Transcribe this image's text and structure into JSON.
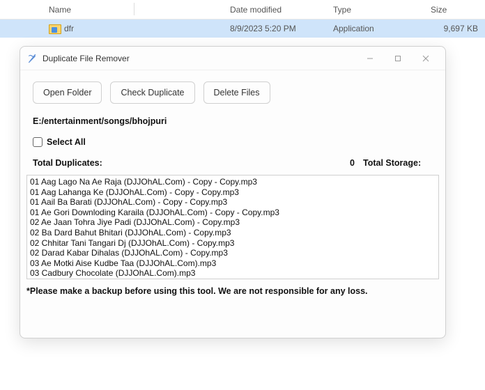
{
  "explorer": {
    "columns": {
      "name": "Name",
      "date": "Date modified",
      "type": "Type",
      "size": "Size"
    },
    "row": {
      "name": "dfr",
      "date": "8/9/2023 5:20 PM",
      "type": "Application",
      "size": "9,697 KB"
    }
  },
  "app": {
    "title": "Duplicate File Remover",
    "buttons": {
      "open": "Open Folder",
      "check": "Check Duplicate",
      "delete": "Delete Files"
    },
    "path": "E:/entertainment/songs/bhojpuri",
    "select_all": "Select All",
    "total_duplicates_label": "Total Duplicates:",
    "total_duplicates_count": "0",
    "total_storage_label": "Total Storage:",
    "files": [
      "01 Aag Lago Na Ae Raja (DJJOhAL.Com) - Copy - Copy.mp3",
      "01 Aag Lahanga Ke (DJJOhAL.Com) - Copy - Copy.mp3",
      "01 Aail Ba Barati (DJJOhAL.Com) - Copy - Copy.mp3",
      "01 Ae Gori Downloding Karaila (DJJOhAL.Com) - Copy - Copy.mp3",
      "02 Ae Jaan Tohra Jiye Padi (DJJOhAL.Com) - Copy.mp3",
      "02 Ba Dard Bahut Bhitari (DJJOhAL.Com) - Copy.mp3",
      "02 Chhitar Tani Tangari Dj (DJJOhAL.Com) - Copy.mp3",
      "02 Darad Kabar Dihalas (DJJOhAL.Com) - Copy.mp3",
      "03 Ae Motki Aise Kudbe Taa (DJJOhAL.Com).mp3",
      "03 Cadbury Chocolate (DJJOhAL.Com).mp3"
    ],
    "disclaimer": "*Please make a backup before using this tool. We are not responsible for any loss."
  }
}
